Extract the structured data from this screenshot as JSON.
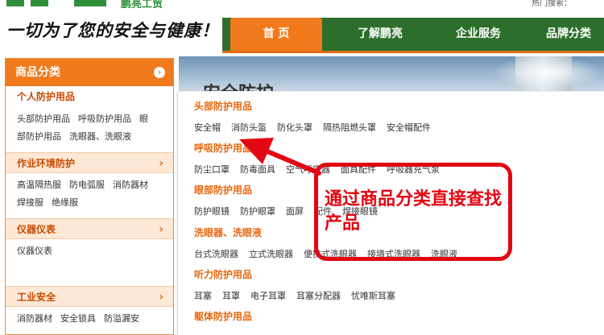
{
  "header": {
    "brand_partial": "鹏亮工贸",
    "top_util": "热门搜索：",
    "slogan": "一切为了您的安全与健康！"
  },
  "nav": {
    "items": [
      "首  页",
      "了解鹏亮",
      "企业服务",
      "品牌分类"
    ]
  },
  "sidebar": {
    "header": "商品分类",
    "header_icon": "chevron-circle-right-icon",
    "categories": [
      {
        "title": "个人防护用品",
        "links": [
          "头部防护用品",
          "呼吸防护用品",
          "眼",
          "部防护用品",
          "洗眼器、洗眼液"
        ]
      },
      {
        "title": "作业环境防护",
        "links": [
          "高温隔热服",
          "防电弧服",
          "消防器材",
          "焊接服",
          "绝缘服"
        ]
      },
      {
        "title": "仪器仪表",
        "links": [
          "仪器仪表"
        ]
      },
      {
        "title": "工业安全",
        "links": [
          "消防器材",
          "安全锁具",
          "防溢漏安"
        ]
      }
    ]
  },
  "banner": {
    "text": "安全防护"
  },
  "dropdown": {
    "sections": [
      {
        "title": "头部防护用品",
        "items": [
          "安全帽",
          "消防头盔",
          "防化头罩",
          "隔热阻燃头罩",
          "安全帽配件"
        ]
      },
      {
        "title": "呼吸防护用品",
        "items": [
          "防尘口罩",
          "防毒面具",
          "空气呼吸器",
          "面具配件",
          "呼吸器充气泵"
        ]
      },
      {
        "title": "眼部防护用品",
        "items": [
          "防护眼镜",
          "防护眼罩",
          "面屏",
          "配件",
          "焊接眼镜"
        ]
      },
      {
        "title": "洗眼器、洗眼液",
        "items": [
          "台式洗眼器",
          "立式洗眼器",
          "便携式洗眼器",
          "接墙式洗眼器",
          "洗眼液"
        ]
      },
      {
        "title": "听力防护用品",
        "items": [
          "耳塞",
          "耳罩",
          "电子耳罩",
          "耳塞分配器",
          "忧唯斯耳塞"
        ]
      },
      {
        "title": "躯体防护用品",
        "items": []
      }
    ]
  },
  "annotation": {
    "text": "通过商品分类直接查找产品",
    "color": "#e30613"
  },
  "colors": {
    "accent_orange": "#f07a1c",
    "nav_green": "#2c6f2c",
    "title_orange": "#e8660d"
  }
}
